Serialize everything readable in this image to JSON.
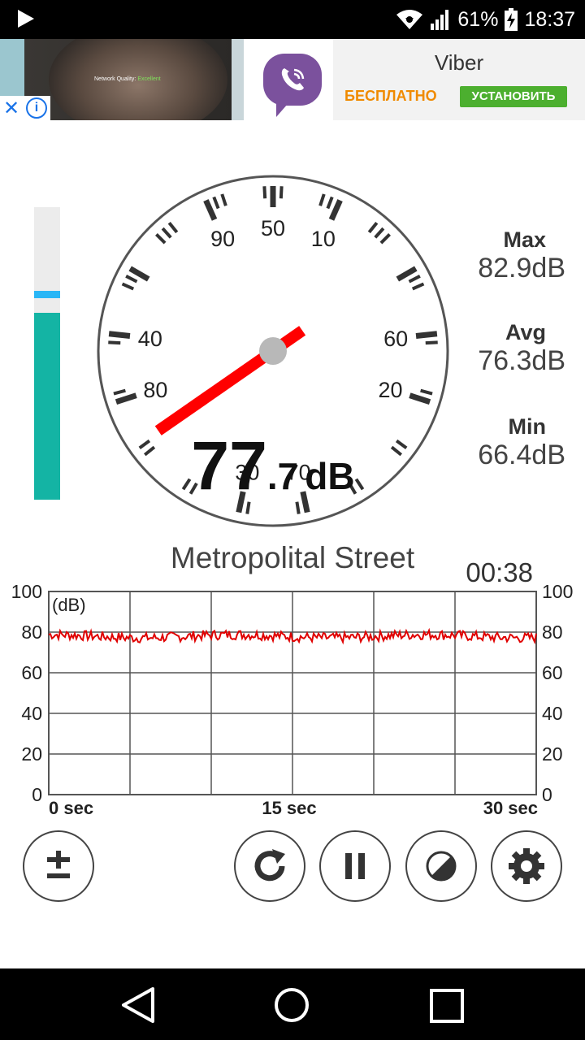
{
  "status_bar": {
    "battery": "61%",
    "time": "18:37"
  },
  "ad": {
    "photo_text": "Network Quality:",
    "photo_text_value": "Excellent",
    "app_name": "Viber",
    "price_label": "БЕСПЛАТНО",
    "install_label": "УСТАНОВИТЬ"
  },
  "gauge": {
    "ticks": [
      "10",
      "20",
      "30",
      "40",
      "50",
      "60",
      "70",
      "80",
      "90"
    ],
    "needle_value": 78,
    "reading_int": "77",
    "reading_dec": ".7",
    "reading_unit": "dB"
  },
  "level_meter": {
    "max": 100,
    "level": 64,
    "peak": 69
  },
  "stats": {
    "max_label": "Max",
    "max_value": "82.9",
    "max_unit": "dB",
    "avg_label": "Avg",
    "avg_value": "76.3",
    "avg_unit": "dB",
    "min_label": "Min",
    "min_value": "66.4",
    "min_unit": "dB"
  },
  "location": "Metropolital Street",
  "elapsed": "00:38",
  "graph": {
    "unit_label": "(dB)",
    "y_ticks": [
      "100",
      "80",
      "60",
      "40",
      "20",
      "0"
    ],
    "x_ticks": [
      "0 sec",
      "15 sec",
      "30 sec"
    ]
  },
  "chart_data": {
    "type": "line",
    "title": "",
    "xlabel": "",
    "ylabel": "(dB)",
    "xlim": [
      0,
      30
    ],
    "ylim": [
      0,
      100
    ],
    "grid": true,
    "series": [
      {
        "color": "#e00000",
        "approx_value": 78,
        "min": 74,
        "max": 83
      }
    ]
  },
  "colors": {
    "needle": "#ff0000",
    "level": "#14b4a4",
    "peak": "#29b6f6",
    "trace": "#e00000"
  },
  "controls": {
    "icons": [
      "plus-minus-icon",
      "refresh-icon",
      "pause-icon",
      "contrast-icon",
      "gear-icon"
    ]
  }
}
